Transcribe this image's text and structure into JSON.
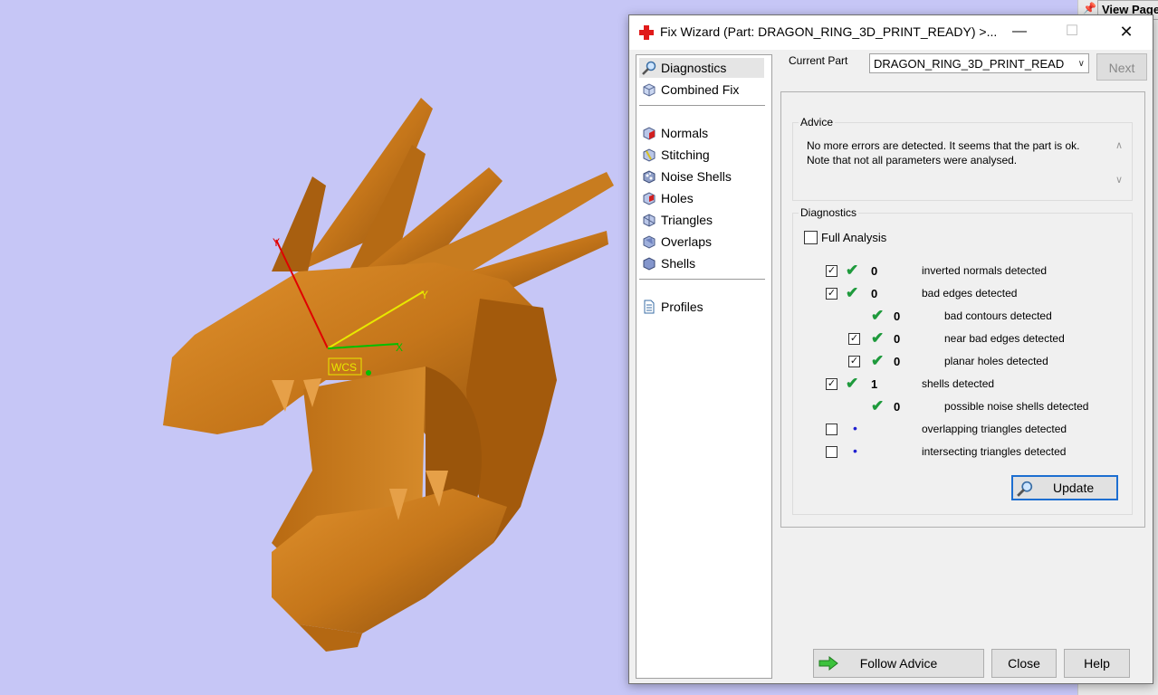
{
  "viewport": {
    "background": "#c6c6f6",
    "model_color": "#c97a1e",
    "axis_labels": {
      "x": "X",
      "y": "Y",
      "z": "Y"
    },
    "wcs_label": "WCS"
  },
  "background_app": {
    "view_page_label": "View Page"
  },
  "window": {
    "title": "Fix Wizard (Part: DRAGON_RING_3D_PRINT_READY) >...",
    "title_icon": "red-cross-icon"
  },
  "nav": {
    "items": [
      {
        "label": "Diagnostics",
        "icon": "magnifier-icon",
        "selected": true
      },
      {
        "label": "Combined Fix",
        "icon": "cube-icon"
      },
      {
        "label": "Normals",
        "icon": "normals-cube-icon"
      },
      {
        "label": "Stitching",
        "icon": "stitching-cube-icon"
      },
      {
        "label": "Noise Shells",
        "icon": "noise-shells-icon"
      },
      {
        "label": "Holes",
        "icon": "holes-cube-icon"
      },
      {
        "label": "Triangles",
        "icon": "triangles-cube-icon"
      },
      {
        "label": "Overlaps",
        "icon": "overlaps-cube-icon"
      },
      {
        "label": "Shells",
        "icon": "shells-cube-icon"
      },
      {
        "label": "Profiles",
        "icon": "document-icon"
      }
    ]
  },
  "current_part": {
    "label": "Current Part",
    "value": "DRAGON_RING_3D_PRINT_READ"
  },
  "next_label": "Next",
  "advice": {
    "title": "Advice",
    "text": "No more errors are detected. It seems that the part is ok. Note that not all parameters were analysed."
  },
  "diagnostics": {
    "title": "Diagnostics",
    "full_analysis_label": "Full Analysis",
    "rows": [
      {
        "checked": true,
        "status": "ok",
        "count": "0",
        "label": "inverted normals detected"
      },
      {
        "checked": true,
        "status": "ok",
        "count": "0",
        "label": "bad edges detected"
      },
      {
        "checked": null,
        "status": "ok",
        "count": "0",
        "label": "bad contours detected"
      },
      {
        "checked": true,
        "status": "ok",
        "count": "0",
        "label": "near bad edges detected"
      },
      {
        "checked": true,
        "status": "ok",
        "count": "0",
        "label": "planar holes detected"
      },
      {
        "checked": true,
        "status": "ok",
        "count": "1",
        "label": "shells detected"
      },
      {
        "checked": null,
        "status": "ok",
        "count": "0",
        "label": "possible noise shells detected"
      },
      {
        "checked": false,
        "status": "pending",
        "count": "",
        "label": "overlapping triangles detected"
      },
      {
        "checked": false,
        "status": "pending",
        "count": "",
        "label": "intersecting triangles detected"
      }
    ],
    "update_label": "Update"
  },
  "buttons": {
    "follow_advice": "Follow Advice",
    "close": "Close",
    "help": "Help"
  },
  "colors": {
    "ok_tick": "#1e9a3c",
    "pending_dot": "#2020d0",
    "focus_border": "#1d6ed1"
  }
}
